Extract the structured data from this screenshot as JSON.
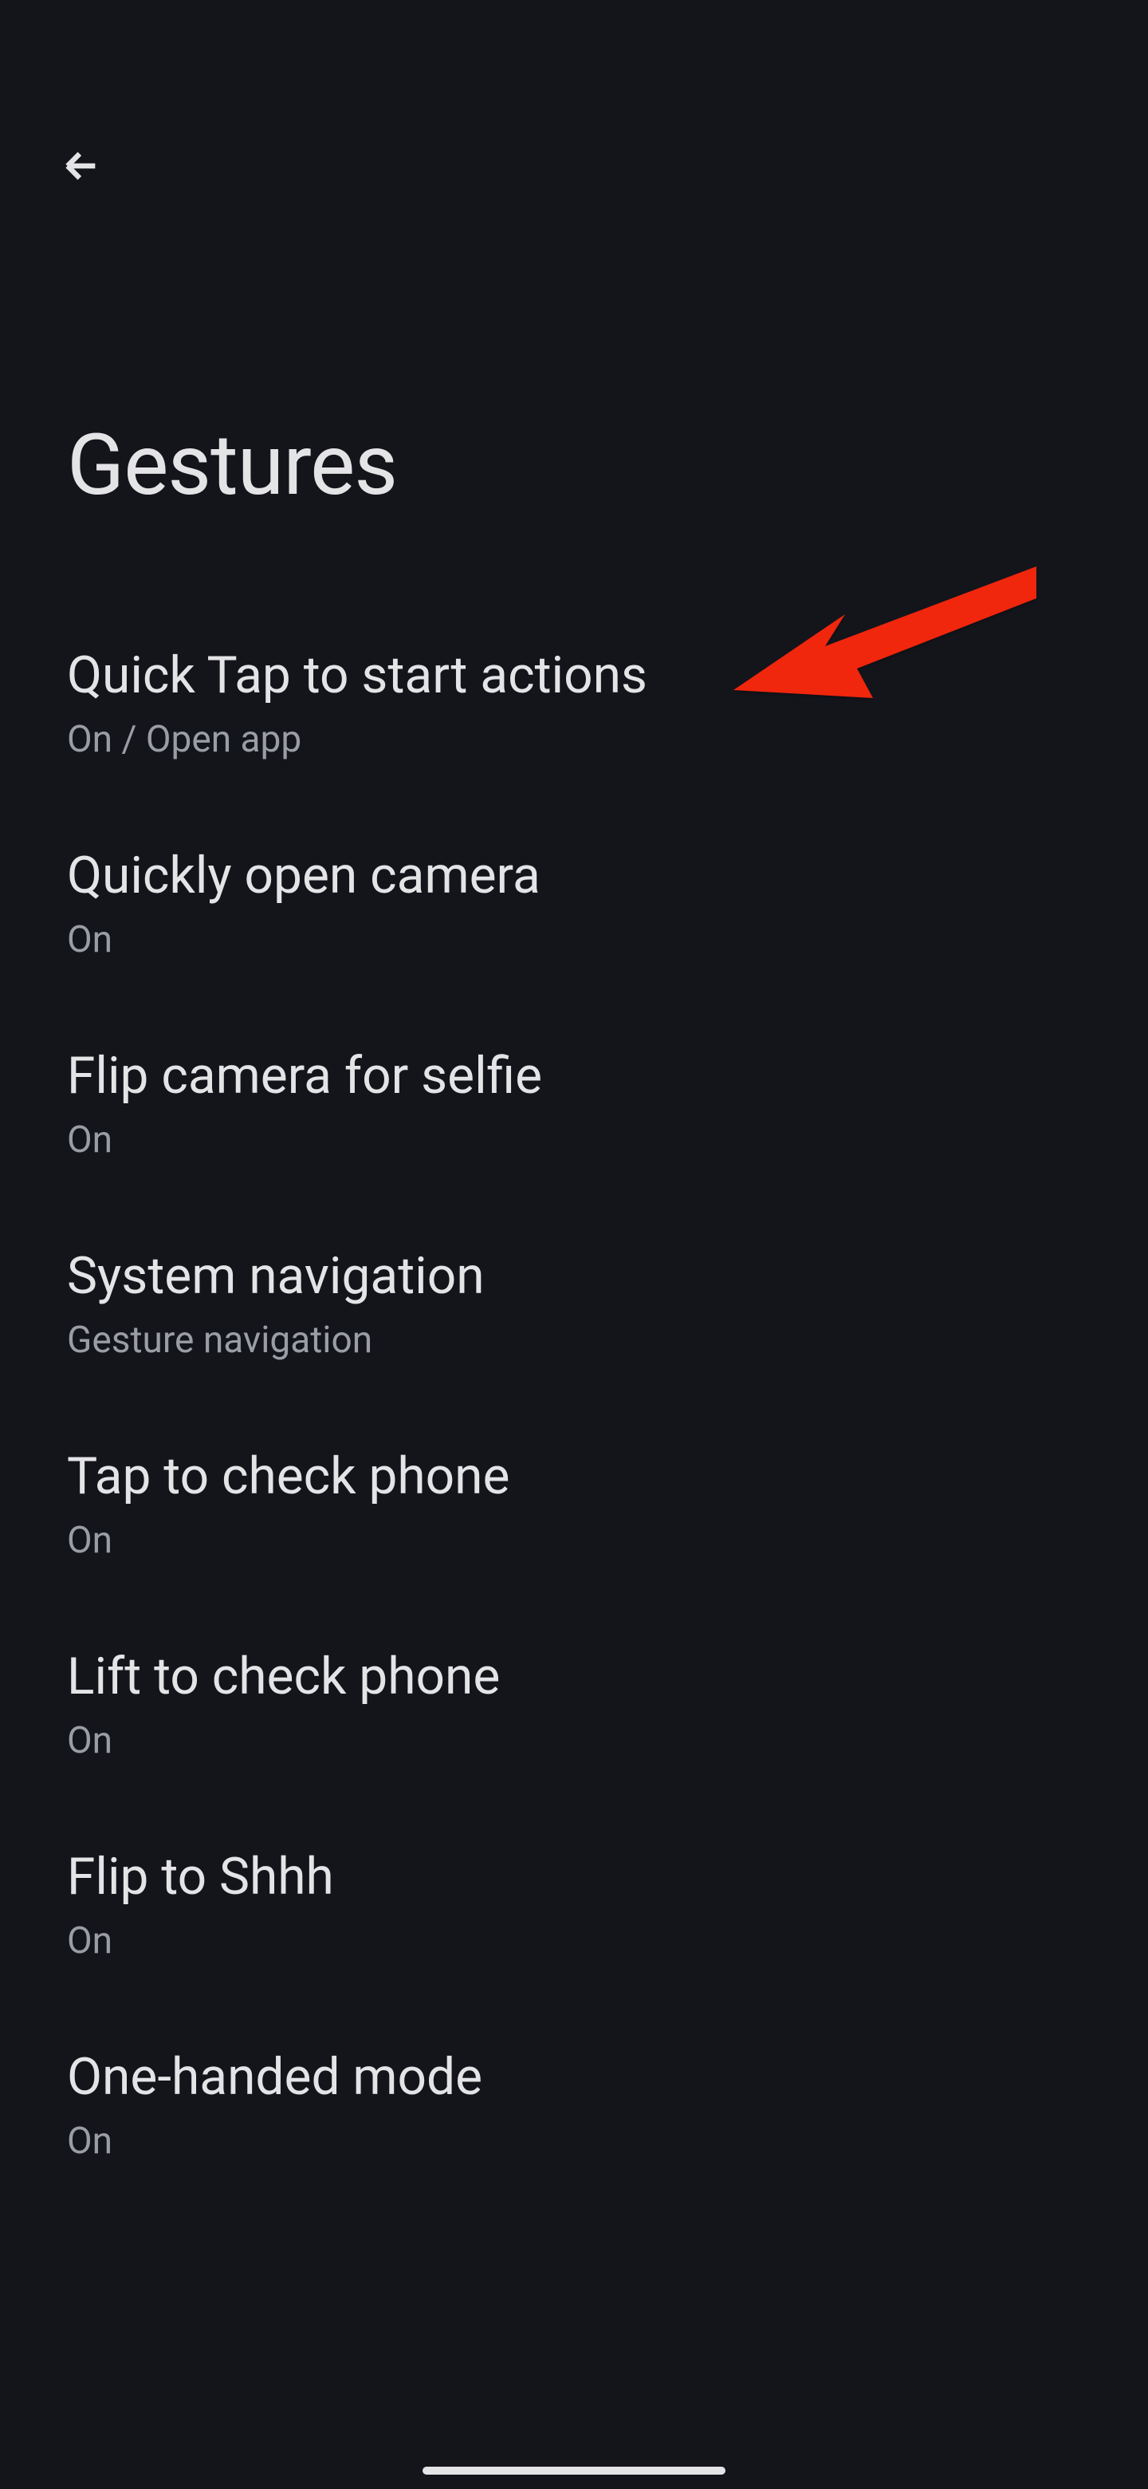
{
  "header": {
    "title": "Gestures"
  },
  "settings": [
    {
      "title": "Quick Tap to start actions",
      "subtitle": "On / Open app"
    },
    {
      "title": "Quickly open camera",
      "subtitle": "On"
    },
    {
      "title": "Flip camera for selfie",
      "subtitle": "On"
    },
    {
      "title": "System navigation",
      "subtitle": "Gesture navigation"
    },
    {
      "title": "Tap to check phone",
      "subtitle": "On"
    },
    {
      "title": "Lift to check phone",
      "subtitle": "On"
    },
    {
      "title": "Flip to Shhh",
      "subtitle": "On"
    },
    {
      "title": "One-handed mode",
      "subtitle": "On"
    }
  ]
}
